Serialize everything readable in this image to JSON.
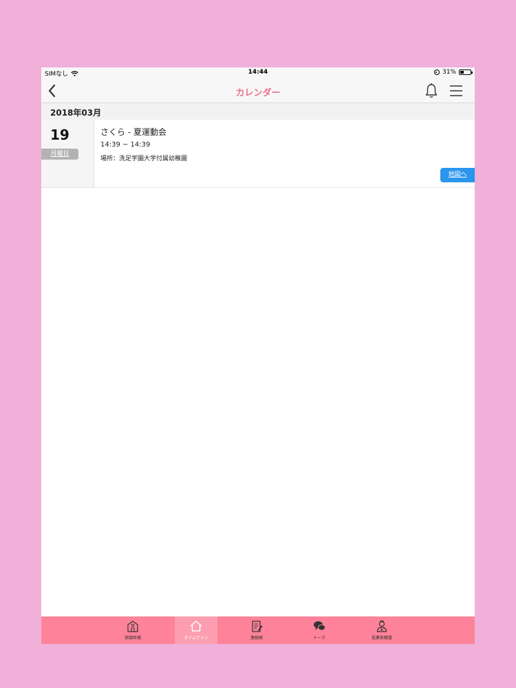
{
  "status_bar": {
    "carrier": "SIMなし",
    "time": "14:44",
    "battery": "31%"
  },
  "nav": {
    "title": "カレンダー",
    "back_icon": "chevron-left-icon",
    "notification_icon": "bell-icon",
    "menu_icon": "hamburger-menu-icon"
  },
  "month_header": "2018年03月",
  "events": [
    {
      "day": "19",
      "weekday": "月曜日",
      "title": "さくら - 夏運動会",
      "time": "14:39 ~ 14:39",
      "location": "場所：洗足学園大学付属幼稚園",
      "map_button": "地図へ"
    }
  ],
  "tab_bar": {
    "items": [
      {
        "label": "実園所様",
        "icon": "school-icon",
        "active": false
      },
      {
        "label": "タイムライン",
        "icon": "home-icon",
        "active": true
      },
      {
        "label": "連絡帳",
        "icon": "notebook-icon",
        "active": false
      },
      {
        "label": "トーク",
        "icon": "chat-icon",
        "active": false
      },
      {
        "label": "投薬依頼書",
        "icon": "nurse-icon",
        "active": false
      }
    ]
  },
  "colors": {
    "background": "#f0b0da",
    "accent": "#ee6f8a",
    "tab_bar": "#fe8299",
    "map_button": "#2a95ec"
  }
}
